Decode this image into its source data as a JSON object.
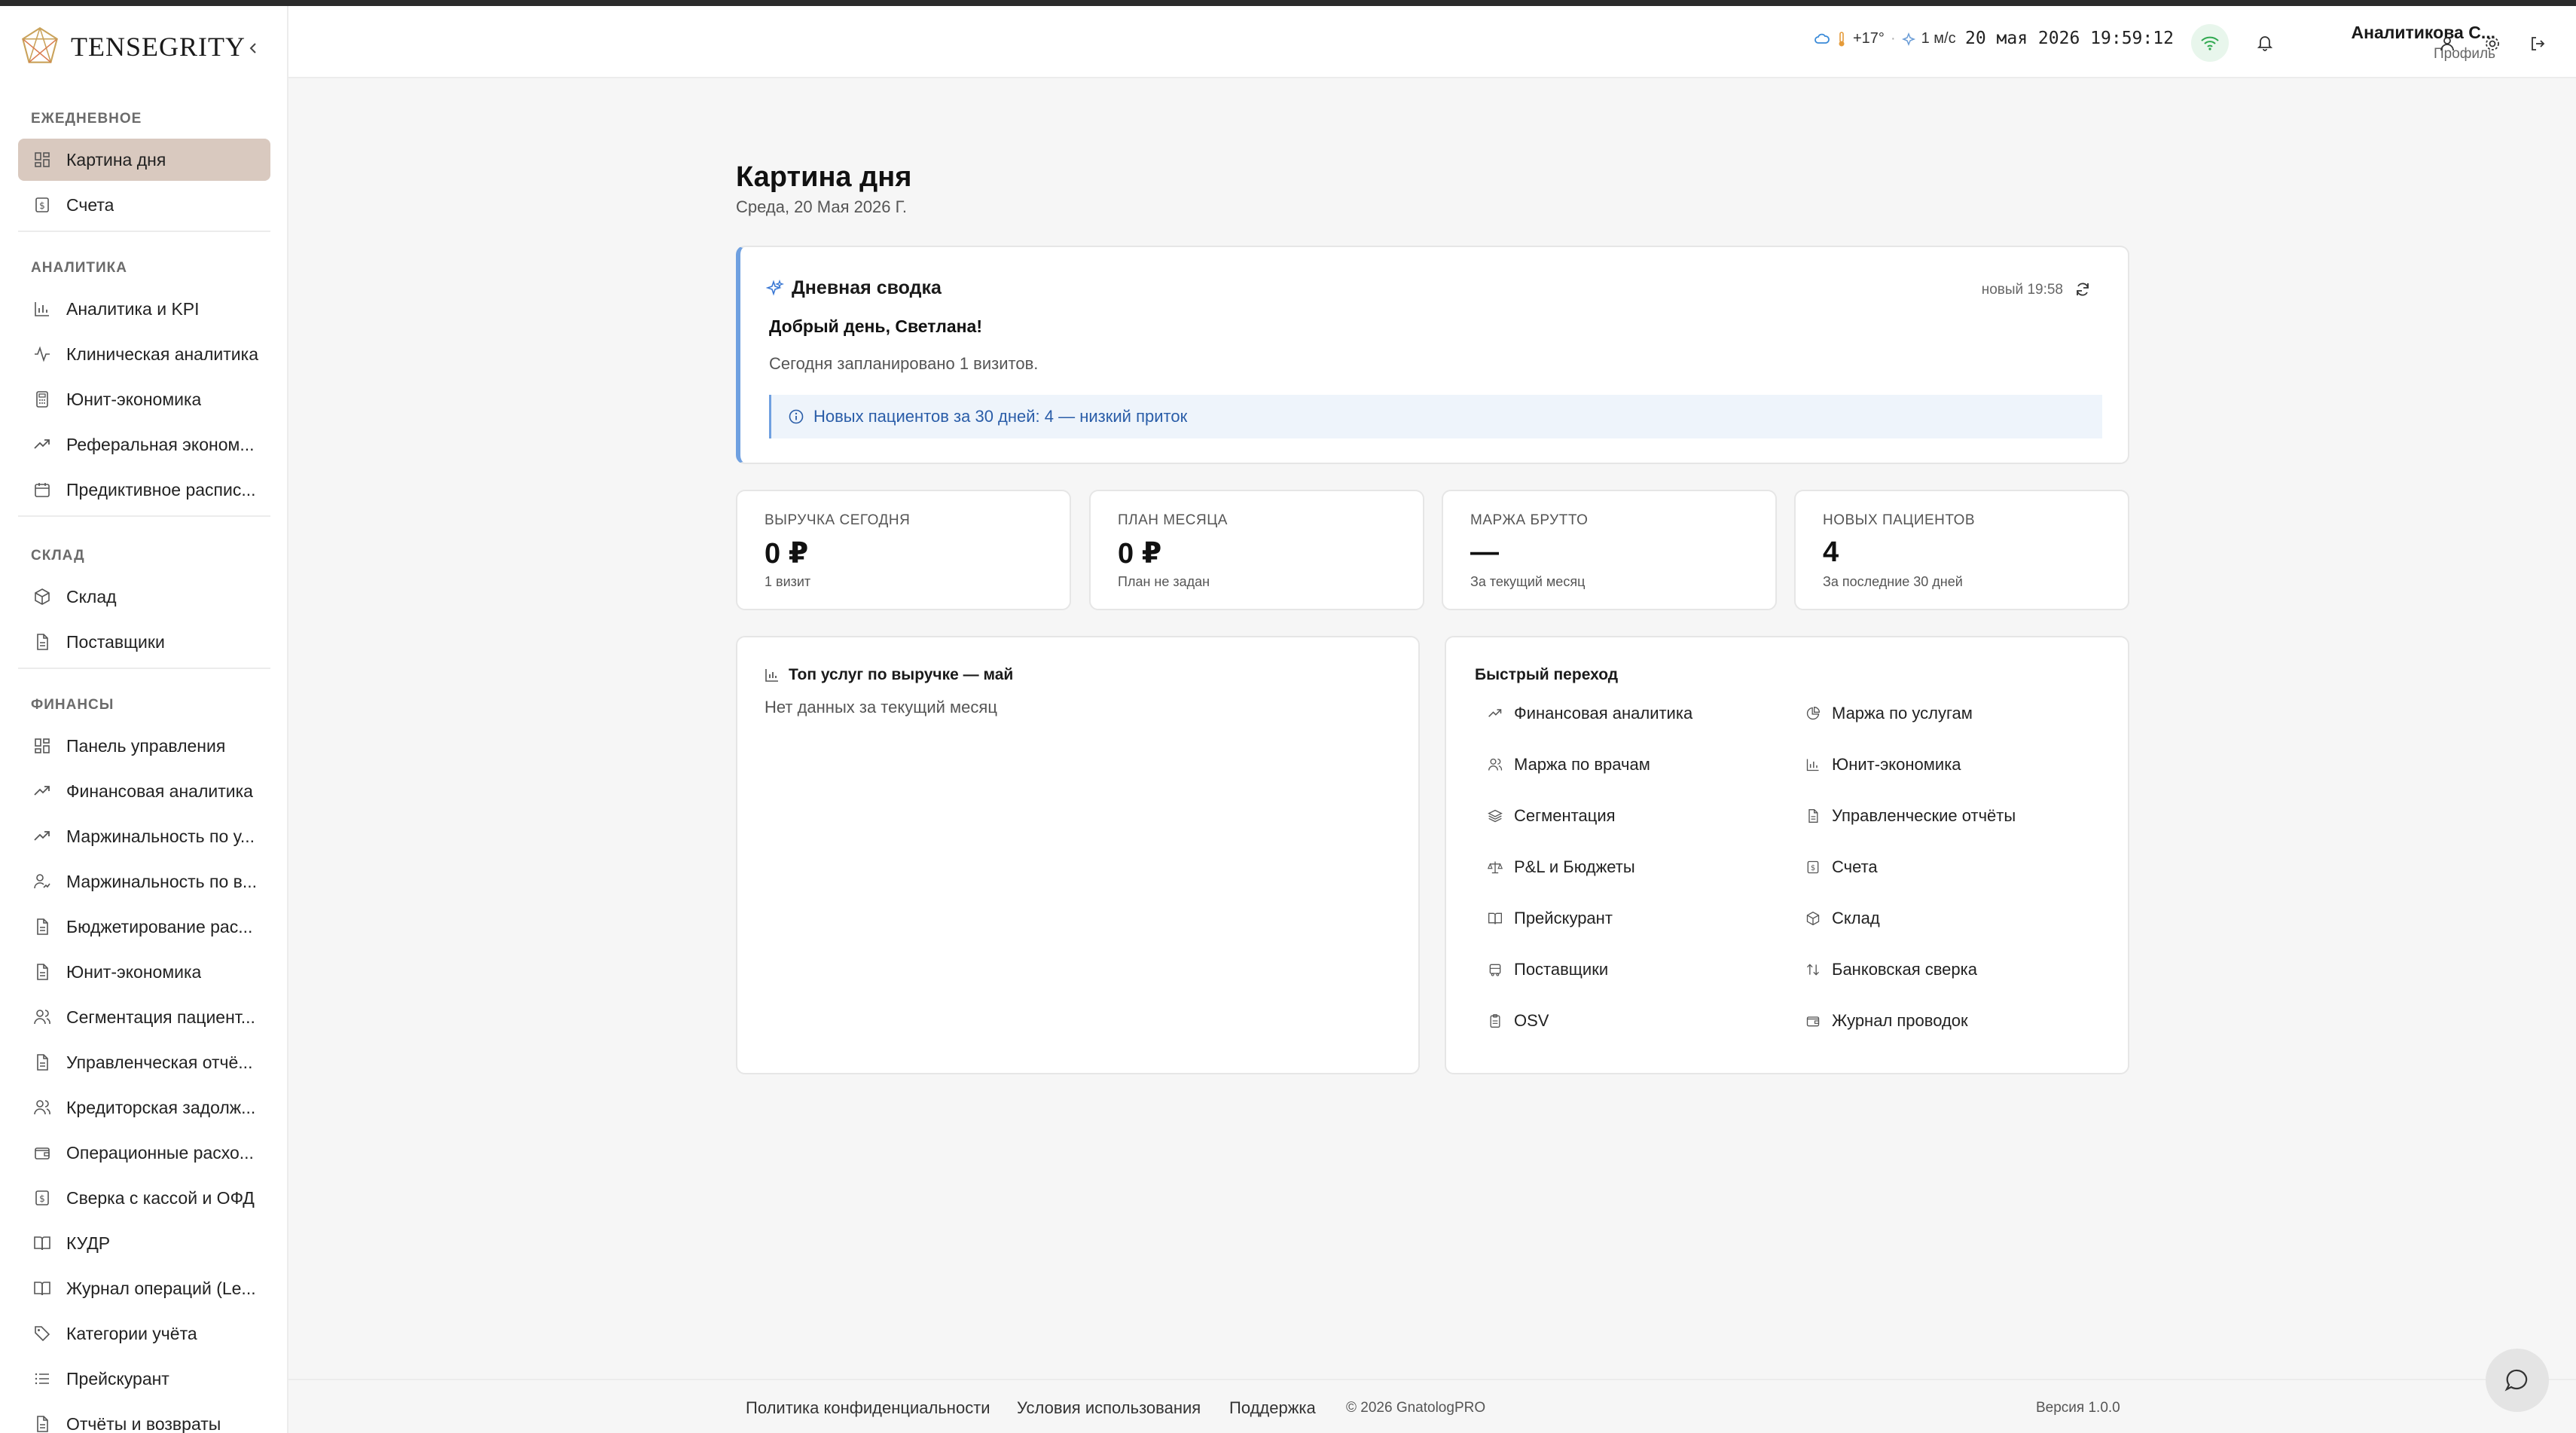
{
  "app": {
    "brand": "TENSEGRITY"
  },
  "sidebar": {
    "sections": [
      {
        "heading": "ЕЖЕДНЕВНОЕ",
        "items": [
          {
            "label": "Картина дня",
            "icon": "dashboard-icon",
            "active": true
          },
          {
            "label": "Счета",
            "icon": "dollar-file-icon"
          }
        ]
      },
      {
        "heading": "АНАЛИТИКА",
        "items": [
          {
            "label": "Аналитика и KPI",
            "icon": "bar-chart-icon"
          },
          {
            "label": "Клиническая аналитика",
            "icon": "pulse-icon"
          },
          {
            "label": "Юнит-экономика",
            "icon": "calculator-icon"
          },
          {
            "label": "Реферальная эконом...",
            "icon": "trend-up-icon"
          },
          {
            "label": "Предиктивное распис...",
            "icon": "calendar-icon"
          }
        ]
      },
      {
        "heading": "СКЛАД",
        "items": [
          {
            "label": "Склад",
            "icon": "box-icon"
          },
          {
            "label": "Поставщики",
            "icon": "file-icon"
          }
        ]
      },
      {
        "heading": "ФИНАНСЫ",
        "items": [
          {
            "label": "Панель управления",
            "icon": "dashboard-icon"
          },
          {
            "label": "Финансовая аналитика",
            "icon": "trend-up-icon"
          },
          {
            "label": "Маржинальность по у...",
            "icon": "trend-up-icon"
          },
          {
            "label": "Маржинальность по в...",
            "icon": "user-trend-icon"
          },
          {
            "label": "Бюджетирование рас...",
            "icon": "file-icon"
          },
          {
            "label": "Юнит-экономика",
            "icon": "file-icon"
          },
          {
            "label": "Сегментация пациент...",
            "icon": "users-icon"
          },
          {
            "label": "Управленческая отчё...",
            "icon": "file-icon"
          },
          {
            "label": "Кредиторская задолж...",
            "icon": "users-icon"
          },
          {
            "label": "Операционные расхо...",
            "icon": "wallet-icon"
          },
          {
            "label": "Сверка с кассой и ОФД",
            "icon": "dollar-file-icon"
          },
          {
            "label": "КУДР",
            "icon": "book-icon"
          },
          {
            "label": "Журнал операций (Le...",
            "icon": "book-icon"
          },
          {
            "label": "Категории учёта",
            "icon": "tag-icon"
          },
          {
            "label": "Прейскурант",
            "icon": "list-icon"
          },
          {
            "label": "Отчёты и возвраты",
            "icon": "file-icon"
          }
        ]
      }
    ]
  },
  "header": {
    "weather_temp": "+17°",
    "weather_wind": "1 м/с",
    "datetime": "20 мая 2026 19:59:12",
    "user_name": "Аналитикова С...",
    "user_sub": "Профиль"
  },
  "page": {
    "title": "Картина дня",
    "date": "Среда, 20 Мая 2026 Г."
  },
  "summary": {
    "title": "Дневная сводка",
    "meta": "новый 19:58",
    "greeting": "Добрый день, Светлана!",
    "text": "Сегодня запланировано 1 визитов.",
    "alert": "Новых пациентов за 30 дней: 4 — низкий приток"
  },
  "kpis": [
    {
      "label": "ВЫРУЧКА СЕГОДНЯ",
      "value": "0 ₽",
      "sub": "1 визит"
    },
    {
      "label": "ПЛАН МЕСЯЦА",
      "value": "0 ₽",
      "sub": "План не задан"
    },
    {
      "label": "МАРЖА БРУТТО",
      "value": "—",
      "sub": "За текущий месяц"
    },
    {
      "label": "НОВЫХ ПАЦИЕНТОВ",
      "value": "4",
      "sub": "За последние 30 дней"
    }
  ],
  "top_services": {
    "title": "Топ услуг по выручке — май",
    "empty": "Нет данных за текущий месяц"
  },
  "quick": {
    "title": "Быстрый переход",
    "items": [
      {
        "label": "Финансовая аналитика",
        "icon": "trend-up-icon"
      },
      {
        "label": "Маржа по услугам",
        "icon": "pie-chart-icon"
      },
      {
        "label": "Маржа по врачам",
        "icon": "users-icon"
      },
      {
        "label": "Юнит-экономика",
        "icon": "bar-chart-icon"
      },
      {
        "label": "Сегментация",
        "icon": "layers-icon"
      },
      {
        "label": "Управленческие отчёты",
        "icon": "file-icon"
      },
      {
        "label": "P&L и Бюджеты",
        "icon": "scale-icon"
      },
      {
        "label": "Счета",
        "icon": "dollar-file-icon"
      },
      {
        "label": "Прейскурант",
        "icon": "book-icon"
      },
      {
        "label": "Склад",
        "icon": "box-icon"
      },
      {
        "label": "Поставщики",
        "icon": "truck-icon"
      },
      {
        "label": "Банковская сверка",
        "icon": "arrows-updown-icon"
      },
      {
        "label": "OSV",
        "icon": "clipboard-icon"
      },
      {
        "label": "Журнал проводок",
        "icon": "wallet-icon"
      }
    ]
  },
  "footer": {
    "privacy": "Политика конфиденциальности",
    "terms": "Условия использования",
    "support": "Поддержка",
    "copyright": "© 2026 GnatologPRO",
    "version": "Версия 1.0.0"
  },
  "colors": {
    "accent": "#6fa0e0",
    "active_bg": "#d9c9bf",
    "brand_gold": "#c9a25a"
  }
}
